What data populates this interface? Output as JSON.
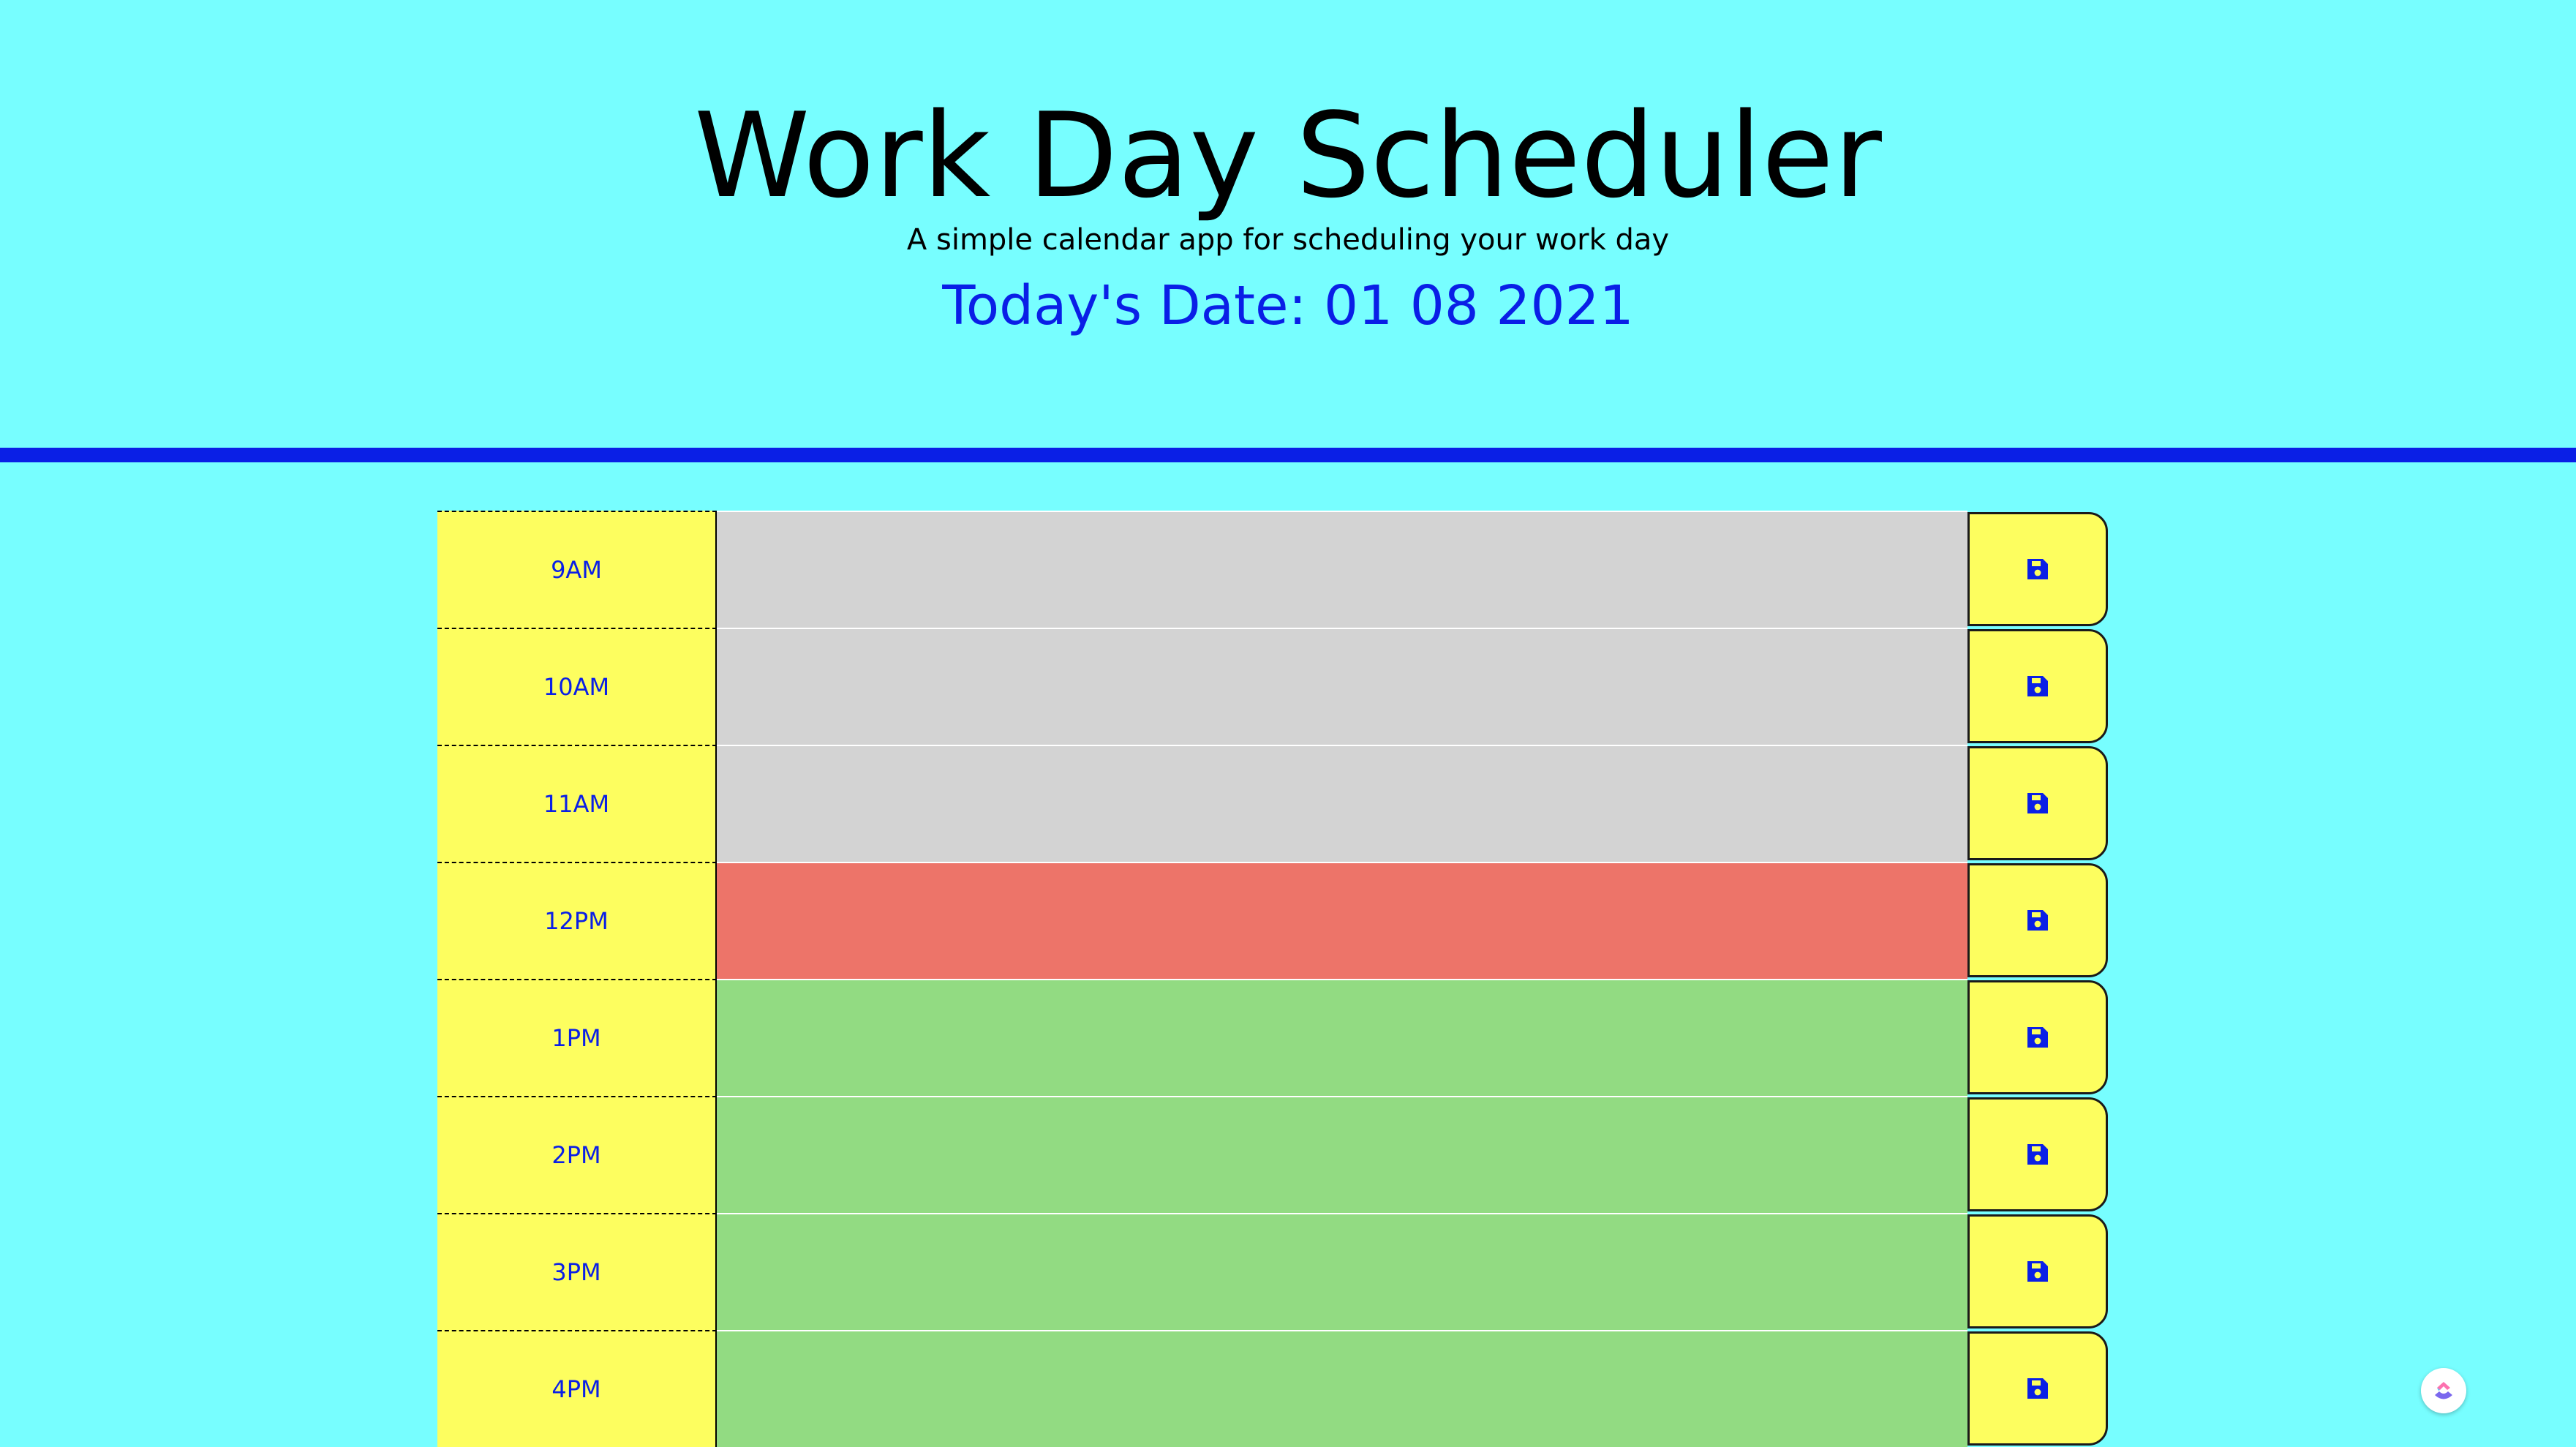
{
  "header": {
    "title": "Work Day Scheduler",
    "subtitle": "A simple calendar app for scheduling your work day",
    "date_label": "Today's Date: 01 08 2021"
  },
  "colors": {
    "background": "#77feff",
    "accent": "#0a1fe6",
    "hour_block": "#fdfe5f",
    "past": "#d3d3d3",
    "present": "#ed7469",
    "future": "#92db82"
  },
  "rows": [
    {
      "hour": "9AM",
      "status": "past",
      "text": "",
      "save_icon": "save-icon"
    },
    {
      "hour": "10AM",
      "status": "past",
      "text": "",
      "save_icon": "save-icon"
    },
    {
      "hour": "11AM",
      "status": "past",
      "text": "",
      "save_icon": "save-icon"
    },
    {
      "hour": "12PM",
      "status": "present",
      "text": "",
      "save_icon": "save-icon"
    },
    {
      "hour": "1PM",
      "status": "future",
      "text": "",
      "save_icon": "save-icon"
    },
    {
      "hour": "2PM",
      "status": "future",
      "text": "",
      "save_icon": "save-icon"
    },
    {
      "hour": "3PM",
      "status": "future",
      "text": "",
      "save_icon": "save-icon"
    },
    {
      "hour": "4PM",
      "status": "future",
      "text": "",
      "save_icon": "save-icon"
    }
  ],
  "widget": {
    "icon": "clickup-icon"
  }
}
